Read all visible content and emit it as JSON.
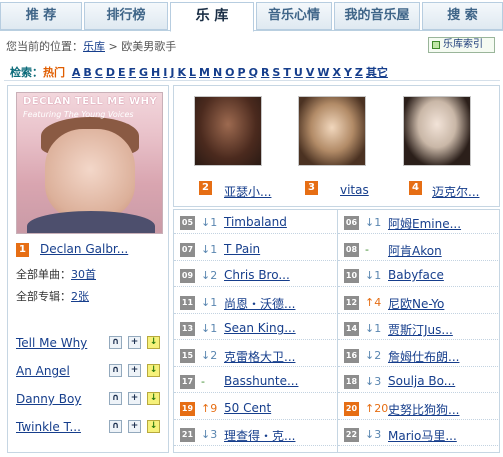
{
  "tabs": [
    "推  荐",
    "排行榜",
    "乐  库",
    "音乐心情",
    "我的音乐屋",
    "搜  索"
  ],
  "breadcrumb": {
    "prefix": "您当前的位置：",
    "link": "乐库",
    "sep": " > ",
    "current": "欧美男歌手"
  },
  "index_button": "乐库索引",
  "alpha_bar": {
    "label": "检索：",
    "hot": "热门",
    "letters": [
      "A",
      "B",
      "C",
      "D",
      "E",
      "F",
      "G",
      "H",
      "I",
      "J",
      "K",
      "L",
      "M",
      "N",
      "O",
      "P",
      "Q",
      "R",
      "S",
      "T",
      "U",
      "V",
      "W",
      "X",
      "Y",
      "Z"
    ],
    "other": "其它"
  },
  "featured": {
    "cover_title": "DECLAN  TELL ME WHY",
    "cover_subtitle": "Featuring The Young Voices",
    "rank": "1",
    "name": "Declan Galbr...",
    "singles_label": "全部单曲：",
    "singles_value": "30首",
    "albums_label": "全部专辑：",
    "albums_value": "2张",
    "songs": [
      "Tell Me Why",
      "An Angel",
      "Danny Boy",
      "Twinkle T..."
    ],
    "song_buttons": {
      "listen": "∩",
      "add": "+",
      "download": "↓"
    }
  },
  "top3": [
    {
      "rank": "2",
      "name": "亚瑟小..."
    },
    {
      "rank": "3",
      "name": "vitas"
    },
    {
      "rank": "4",
      "name": "迈克尔..."
    }
  ],
  "chart_left": [
    {
      "rank": "05",
      "trend": "↓1",
      "dir": "down",
      "name": "Timbaland"
    },
    {
      "rank": "07",
      "trend": "↓1",
      "dir": "down",
      "name": "T Pain"
    },
    {
      "rank": "09",
      "trend": "↓2",
      "dir": "down",
      "name": "Chris Bro..."
    },
    {
      "rank": "11",
      "trend": "↓1",
      "dir": "down",
      "name": "尚恩・沃德..."
    },
    {
      "rank": "13",
      "trend": "↓1",
      "dir": "down",
      "name": "Sean King..."
    },
    {
      "rank": "15",
      "trend": "↓2",
      "dir": "down",
      "name": "克雷格大卫..."
    },
    {
      "rank": "17",
      "trend": "-",
      "dir": "flat",
      "name": "Basshunte..."
    },
    {
      "rank": "19",
      "trend": "↑9",
      "dir": "up",
      "name": "50 Cent"
    },
    {
      "rank": "21",
      "trend": "↓3",
      "dir": "down",
      "name": "理查得・克..."
    }
  ],
  "chart_right": [
    {
      "rank": "06",
      "trend": "↓1",
      "dir": "down",
      "name": "阿姆Emine..."
    },
    {
      "rank": "08",
      "trend": "-",
      "dir": "flat",
      "name": "阿肯Akon"
    },
    {
      "rank": "10",
      "trend": "↓1",
      "dir": "down",
      "name": "Babyface"
    },
    {
      "rank": "12",
      "trend": "↑4",
      "dir": "up",
      "name": "尼欧Ne-Yo"
    },
    {
      "rank": "14",
      "trend": "↓1",
      "dir": "down",
      "name": "贾斯汀Jus..."
    },
    {
      "rank": "16",
      "trend": "↓2",
      "dir": "down",
      "name": "詹姆仕布朗..."
    },
    {
      "rank": "18",
      "trend": "↓3",
      "dir": "down",
      "name": "Soulja Bo..."
    },
    {
      "rank": "20",
      "trend": "↑20",
      "dir": "up",
      "name": "史努比狗狗..."
    },
    {
      "rank": "22",
      "trend": "↓3",
      "dir": "down",
      "name": "Mario马里..."
    }
  ]
}
